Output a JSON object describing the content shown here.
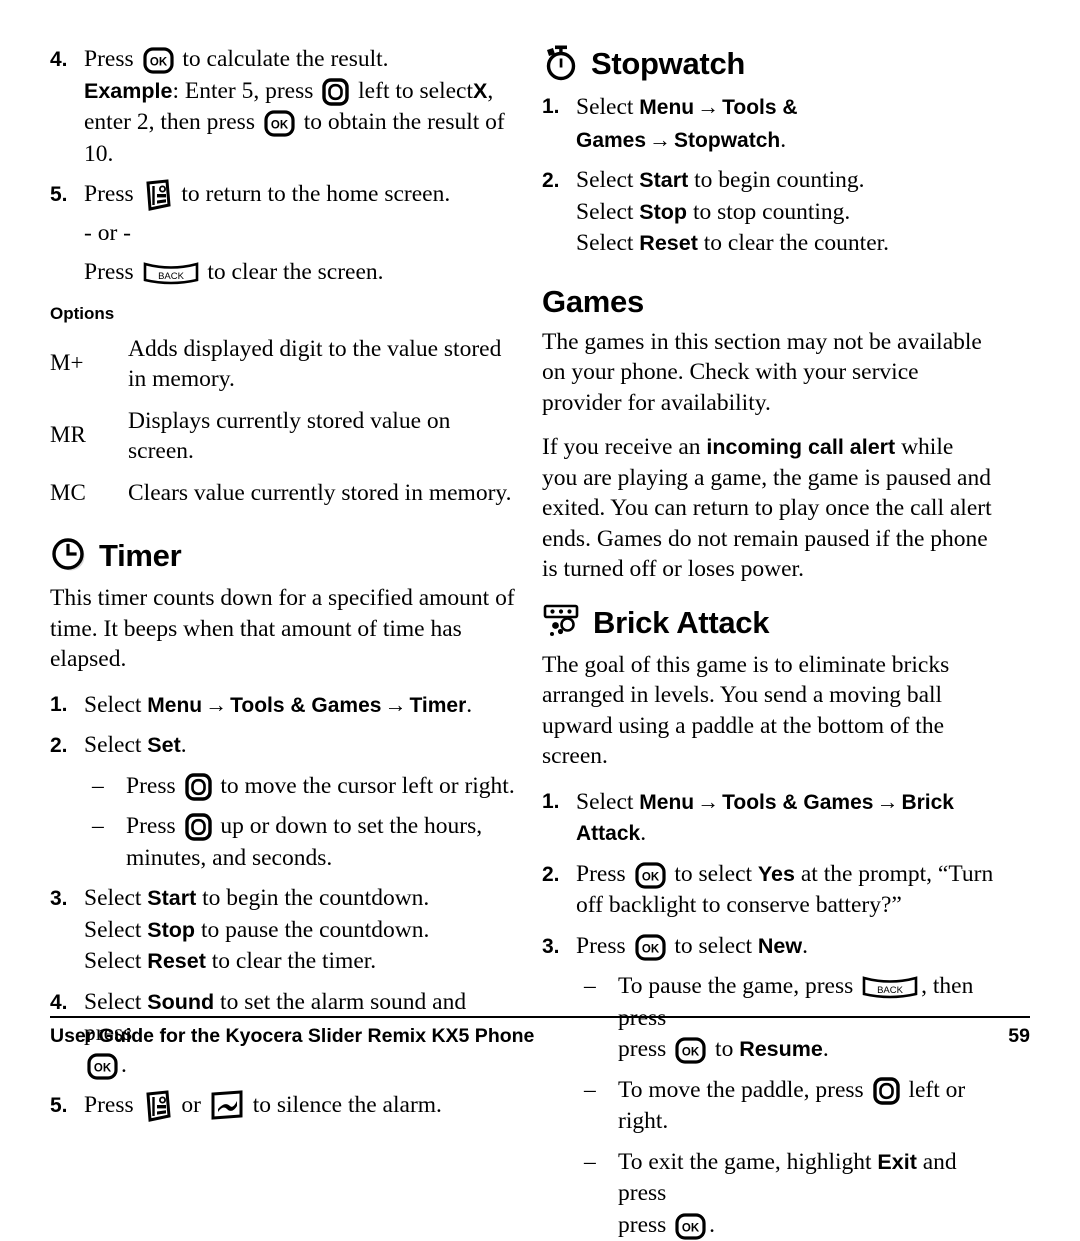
{
  "page": {
    "number": "59",
    "footer_title": "User Guide for the Kyocera Slider Remix KX5 Phone"
  },
  "left_column": {
    "calculator_steps": {
      "step4": {
        "marker": "4.",
        "text_a": "Press",
        "icon_a": "ok-key-icon",
        "text_b": "to calculate the result.",
        "example_label": "Example",
        "example_a": ": Enter 5, press",
        "icon_b": "navigation-key-icon",
        "example_b": "left to select",
        "example_bold": "X",
        "example_c": ", enter 2, then press",
        "icon_c": "ok-key-icon",
        "example_d": "to obtain the result of 10."
      },
      "step5": {
        "marker": "5.",
        "text_a": "Press",
        "icon_a": "end-key-icon",
        "text_b": "to return to the home screen.",
        "or_text": "- or -",
        "text_c": "Press",
        "icon_b": "back-key-icon",
        "text_d": "to clear the screen."
      }
    },
    "options": {
      "heading": "Options",
      "rows": [
        {
          "key": "M+",
          "description": "Adds displayed digit to the value stored in memory."
        },
        {
          "key": "MR",
          "description": "Displays currently stored value on screen."
        },
        {
          "key": "MC",
          "description": "Clears value currently stored in memory."
        }
      ]
    },
    "timer": {
      "icon": "clock-icon",
      "heading": "Timer",
      "intro": "This timer counts down for a specified amount of time. It beeps when that amount of time has elapsed.",
      "step1": {
        "marker": "1.",
        "select": "Select",
        "path": [
          "Menu",
          "Tools & Games",
          "Timer"
        ],
        "period": "."
      },
      "step2": {
        "marker": "2.",
        "select": "Select",
        "bold": "Set",
        "period": "."
      },
      "sub1": {
        "marker": "–",
        "text_a": "Press",
        "icon": "navigation-key-icon",
        "text_b": "to move the cursor left or right."
      },
      "sub2": {
        "marker": "–",
        "text_a": "Press",
        "icon": "navigation-key-icon",
        "text_b": "up or down to set the hours, minutes, and seconds."
      },
      "step3": {
        "marker": "3.",
        "line1_a": "Select",
        "line1_bold": "Start",
        "line1_b": "to begin the countdown.",
        "line2_a": "Select",
        "line2_bold": "Stop",
        "line2_b": "to pause the countdown.",
        "line3_a": "Select",
        "line3_bold": "Reset",
        "line3_b": "to clear the timer."
      },
      "step4": {
        "marker": "4.",
        "text_a": "Select",
        "bold": "Sound",
        "text_b": "to set the alarm sound and press",
        "icon": "ok-key-icon",
        "text_c": "."
      },
      "step5": {
        "marker": "5.",
        "text_a": "Press",
        "icon_a": "end-key-icon",
        "text_b": "or",
        "icon_b": "side-key-icon",
        "text_c": "to silence the alarm."
      }
    }
  },
  "right_column": {
    "stopwatch": {
      "icon": "stopwatch-icon",
      "heading": "Stopwatch",
      "step1": {
        "marker": "1.",
        "select": "Select",
        "path": [
          "Menu",
          "Tools & Games",
          "Stopwatch"
        ],
        "period": "."
      },
      "step2": {
        "marker": "2.",
        "line1_a": "Select",
        "line1_bold": "Start",
        "line1_b": "to begin counting.",
        "line2_a": "Select",
        "line2_bold": "Stop",
        "line2_b": "to stop counting.",
        "line3_a": "Select",
        "line3_bold": "Reset",
        "line3_b": "to clear the counter."
      }
    },
    "games": {
      "heading": "Games",
      "para1": "The games in this section may not be available on your phone. Check with your service provider for availability.",
      "para2_a": "If you receive an",
      "para2_bold": "incoming call alert",
      "para2_b": "while you are playing a game, the game is paused and exited. You can return to play once the call alert ends. Games do not remain paused if the phone is turned off or loses power."
    },
    "brick_attack": {
      "icon": "brick-attack-icon",
      "heading": "Brick Attack",
      "intro": "The goal of this game is to eliminate bricks arranged in levels. You send a moving ball upward using a paddle at the bottom of the screen.",
      "step1": {
        "marker": "1.",
        "select": "Select",
        "path": [
          "Menu",
          "Tools & Games",
          "Brick Attack"
        ],
        "period": "."
      },
      "step2": {
        "marker": "2.",
        "text_a": "Press",
        "icon": "ok-key-icon",
        "text_b": "to select",
        "bold": "Yes",
        "text_c": "at the prompt, “Turn off backlight to conserve battery?”"
      },
      "step3": {
        "marker": "3.",
        "text_a": "Press",
        "icon": "ok-key-icon",
        "text_b": "to select",
        "bold": "New",
        "text_c": "."
      },
      "sub1": {
        "marker": "–",
        "text_a": "To pause the game, press",
        "icon_a": "back-key-icon",
        "text_b": ", then press",
        "icon_b": "ok-key-icon",
        "text_c": "to",
        "bold": "Resume",
        "text_d": "."
      },
      "sub2": {
        "marker": "–",
        "text_a": "To move the paddle, press",
        "icon": "navigation-key-icon",
        "text_b": "left or right."
      },
      "sub3": {
        "marker": "–",
        "text_a": "To exit the game, highlight",
        "bold": "Exit",
        "text_b": "and press",
        "icon": "ok-key-icon",
        "text_c": "."
      }
    }
  },
  "colors": {
    "ink": "#000000",
    "paper": "#ffffff"
  }
}
